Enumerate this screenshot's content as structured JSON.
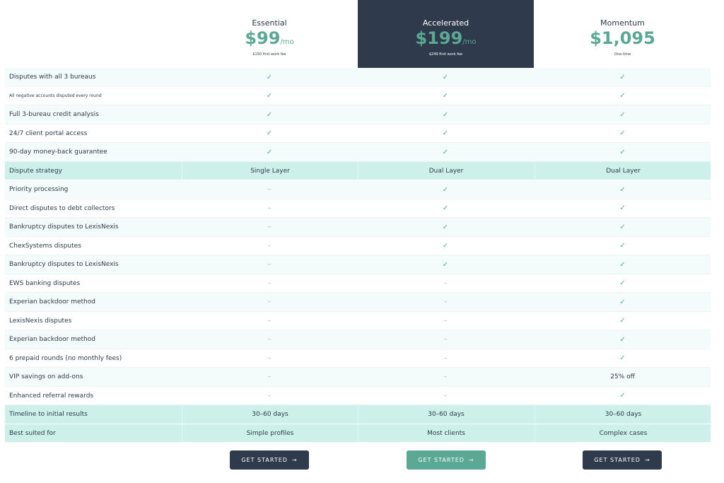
{
  "plans": [
    {
      "name": "Essential",
      "price": "$99",
      "period": "/mo",
      "fee": "$150 first work fee"
    },
    {
      "name": "Accelerated",
      "price": "$199",
      "period": "/mo",
      "fee": "$249 first work fee"
    },
    {
      "name": "Momentum",
      "price": "$1,095",
      "period": "",
      "fee": "One-time"
    }
  ],
  "rows": [
    {
      "label": "Disputes with all 3 bureaus",
      "values": [
        "check-icon",
        "check-icon",
        "check-icon"
      ]
    },
    {
      "label": "All negative accounts disputed every round",
      "values": [
        "check-icon",
        "check-icon",
        "check-icon"
      ]
    },
    {
      "label": "Full 3-bureau credit analysis",
      "values": [
        "check-icon",
        "check-icon",
        "check-icon"
      ]
    },
    {
      "label": "24/7 client portal access",
      "values": [
        "check-icon",
        "check-icon",
        "check-icon"
      ]
    },
    {
      "label": "90-day money-back guarantee",
      "values": [
        "check-icon",
        "check-icon",
        "check-icon"
      ]
    },
    {
      "label": "Dispute strategy",
      "values": [
        "Single Layer",
        "Dual Layer",
        "Dual Layer"
      ],
      "highlight": true
    },
    {
      "label": "Priority processing",
      "values": [
        "–",
        "check-icon",
        "check-icon"
      ]
    },
    {
      "label": "Direct disputes to debt collectors",
      "values": [
        "–",
        "check-icon",
        "check-icon"
      ]
    },
    {
      "label": "Bankruptcy disputes to LexisNexis",
      "values": [
        "–",
        "check-icon",
        "check-icon"
      ]
    },
    {
      "label": "ChexSystems disputes",
      "values": [
        "–",
        "check-icon",
        "check-icon"
      ]
    },
    {
      "label": "Bankruptcy disputes to LexisNexis",
      "values": [
        "–",
        "check-icon",
        "check-icon"
      ]
    },
    {
      "label": "EWS banking disputes",
      "values": [
        "–",
        "–",
        "check-icon"
      ]
    },
    {
      "label": "Experian backdoor method",
      "values": [
        "–",
        "–",
        "check-icon"
      ]
    },
    {
      "label": "LexisNexis disputes",
      "values": [
        "–",
        "–",
        "check-icon"
      ]
    },
    {
      "label": "Experian backdoor method",
      "values": [
        "–",
        "–",
        "check-icon"
      ]
    },
    {
      "label": "6 prepaid rounds (no monthly fees)",
      "values": [
        "–",
        "–",
        "check-icon"
      ]
    },
    {
      "label": "VIP savings on add-ons",
      "values": [
        "–",
        "–",
        "25% off"
      ]
    },
    {
      "label": "Enhanced referral rewards",
      "values": [
        "–",
        "–",
        "check-icon"
      ]
    },
    {
      "label": "Timeline to initial results",
      "values": [
        "30–60 days",
        "30–60 days",
        "30–60 days"
      ],
      "highlight": true
    },
    {
      "label": "Best suited for",
      "values": [
        "Simple profiles",
        "Most clients",
        "Complex cases"
      ],
      "highlight": true
    }
  ],
  "buttons": [
    {
      "label": "GET STARTED",
      "style": "dark"
    },
    {
      "label": "GET STARTED",
      "style": "teal"
    },
    {
      "label": "GET STARTED",
      "style": "dark"
    }
  ],
  "colors": {
    "accent": "#5ba894",
    "dark": "#2f3b4c",
    "highlight_row": "#cdf1ea"
  }
}
